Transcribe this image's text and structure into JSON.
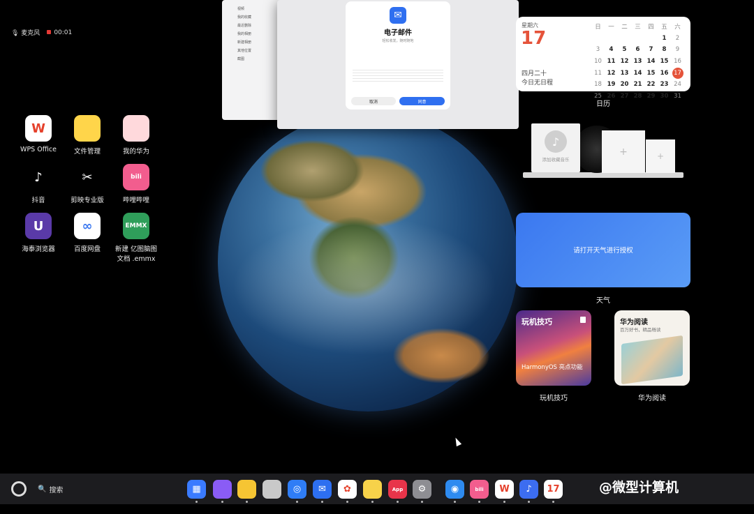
{
  "status": {
    "mic_label": "麦克风",
    "rec_time": "00:01"
  },
  "desktop_icons": [
    {
      "label": "WPS Office",
      "icon": "wps-icon",
      "glyph": "W"
    },
    {
      "label": "文件管理",
      "icon": "folder-icon",
      "glyph": ""
    },
    {
      "label": "我的华为",
      "icon": "myhuawei-icon",
      "glyph": ""
    },
    {
      "label": "抖音",
      "icon": "douyin-icon",
      "glyph": "♪"
    },
    {
      "label": "剪映专业版",
      "icon": "capcut-icon",
      "glyph": "✂"
    },
    {
      "label": "哔哩哔哩",
      "icon": "bilibili-icon",
      "glyph": "bili"
    },
    {
      "label": "海泰浏览器",
      "icon": "browser-icon",
      "glyph": "U"
    },
    {
      "label": "百度网盘",
      "icon": "baidu-pan-icon",
      "glyph": "∞"
    },
    {
      "label": "新建 亿图脑图\n文档 .emmx",
      "icon": "emmx-file-icon",
      "glyph": "EMMX"
    }
  ],
  "mail_window": {
    "title": "电子邮件",
    "subtitle": "轻松收发，随时随地",
    "cancel": "取消",
    "confirm": "同意",
    "sidebar": [
      "视频",
      "我的收藏",
      "最近删除",
      "我的相册",
      "新建相册",
      "其他位置",
      "截图"
    ]
  },
  "calendar": {
    "weekday": "星期六",
    "day": "17",
    "lunar": "四月二十",
    "no_event": "今日无日程",
    "headers": [
      "日",
      "一",
      "二",
      "三",
      "四",
      "五",
      "六"
    ],
    "weeks": [
      [
        "",
        "",
        "",
        "",
        "",
        "1",
        "2"
      ],
      [
        "3",
        "4",
        "5",
        "6",
        "7",
        "8",
        "9"
      ],
      [
        "10",
        "11",
        "12",
        "13",
        "14",
        "15",
        "16"
      ],
      [
        "11",
        "12",
        "13",
        "14",
        "15",
        "16",
        "17"
      ],
      [
        "18",
        "19",
        "20",
        "21",
        "22",
        "23",
        "24"
      ],
      [
        "25",
        "26",
        "27",
        "28",
        "29",
        "30",
        "31"
      ]
    ],
    "label": "日历"
  },
  "music": {
    "add_label": "添加收藏音乐"
  },
  "weather": {
    "prompt": "请打开天气进行授权",
    "label": "天气"
  },
  "tips": {
    "card_title": "玩机技巧",
    "card_sub": "HarmonyOS 亮点功能",
    "label": "玩机技巧"
  },
  "reading": {
    "card_title": "华为阅读",
    "card_sub": "百万好书，精品畅读",
    "label": "华为阅读"
  },
  "dock": {
    "search_label": "搜索",
    "apps": [
      {
        "name": "app-center-icon",
        "color": "#3a7bff",
        "glyph": "▦"
      },
      {
        "name": "multitask-icon",
        "color": "#8a5cf5",
        "glyph": ""
      },
      {
        "name": "notes-icon",
        "color": "#f6c533",
        "glyph": ""
      },
      {
        "name": "trash-icon",
        "color": "#c9c9c9",
        "glyph": ""
      },
      {
        "name": "browser-icon",
        "color": "#2f7df6",
        "glyph": "◎"
      },
      {
        "name": "mail-icon",
        "color": "#2d6ff0",
        "glyph": "✉"
      },
      {
        "name": "gallery-icon",
        "color": "#ffffff",
        "glyph": "✿"
      },
      {
        "name": "memo-icon",
        "color": "#f7d24a",
        "glyph": ""
      },
      {
        "name": "appgallery-icon",
        "color": "#e8344a",
        "glyph": "App"
      },
      {
        "name": "settings-icon",
        "color": "#8e8e93",
        "glyph": "⚙"
      },
      {
        "name": "file-manager-icon",
        "color": "#2e8bf0",
        "glyph": "◉"
      },
      {
        "name": "bilibili-icon",
        "color": "#f25d8e",
        "glyph": "bili"
      },
      {
        "name": "wps-icon",
        "color": "#ffffff",
        "glyph": "W"
      },
      {
        "name": "music-icon",
        "color": "#3c6df0",
        "glyph": "♪"
      },
      {
        "name": "calendar-icon",
        "color": "#ffffff",
        "glyph": "17"
      }
    ]
  },
  "watermark": "@微型计算机"
}
